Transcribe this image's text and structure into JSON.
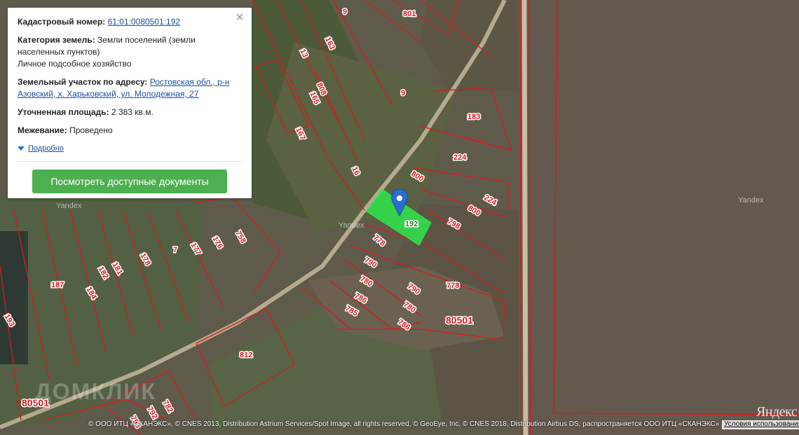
{
  "info_card": {
    "cadastral_label": "Кадастровый номер:",
    "cadastral_value": "61:01:0080501:192",
    "category_label": "Категория земель:",
    "category_value": "Земли поселений (земли населенных пунктов)",
    "usage_value": "Личное подсобное хозяйство",
    "address_label": "Земельный участок по адресу:",
    "address_value": "Ростовская обл., р-н Азовский, х. Харьковский, ул. Молодежная, 27",
    "area_label": "Уточненная площадь:",
    "area_value": "2 383 кв.м.",
    "survey_label": "Межевание:",
    "survey_value": "Проведено",
    "more_label": "Подробно",
    "docs_button": "Посмотреть доступные документы",
    "close_icon": "close-icon"
  },
  "map": {
    "plot_labels": [
      "9",
      "801",
      "13",
      "163",
      "808",
      "165",
      "9",
      "167",
      "183",
      "16",
      "224",
      "800",
      "224",
      "800",
      "798",
      "192",
      "778",
      "790",
      "780",
      "790",
      "786",
      "780",
      "785",
      "786",
      "778",
      "80501",
      "812",
      "758",
      "7",
      "176",
      "177",
      "178",
      "181",
      "182",
      "184",
      "187",
      "193",
      "80501",
      "792",
      "782",
      "793"
    ],
    "selected_plot": "192",
    "watermarks": [
      "Yandex",
      "Yandex",
      "Yandex"
    ],
    "highlight_color": "#2ee84a",
    "boundary_color": "#d61b22",
    "marker_color": "#2a6fcf"
  },
  "footer": {
    "copyright": "© ООО ИТЦ «СКАНЭКС», © CNES 2013, Distribution Astrium Services/Spot Image, all rights reserved, © GeoEye, Inc, © CNES 2018, Distribution Airbus DS, распространяется ООО ИТЦ «СКАНЭКС»",
    "terms": "Условия использования",
    "yandex_logo": "Яндекс",
    "domclick_watermark": "ДОМКЛИК"
  }
}
